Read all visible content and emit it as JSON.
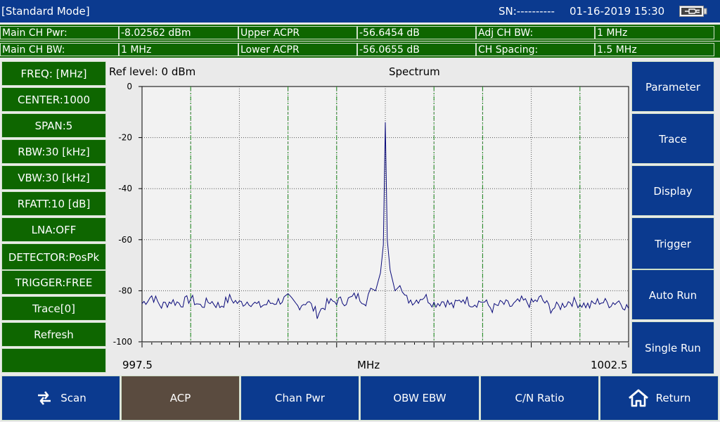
{
  "header": {
    "mode": "[Standard Mode]",
    "sn": "SN:----------",
    "datetime": "01-16-2019 15:30",
    "battery_icon": "battery-plug-icon"
  },
  "measurements": {
    "row1": [
      {
        "label": "Main CH Pwr:",
        "value": "-8.02562 dBm"
      },
      {
        "label": "Upper ACPR",
        "value": "-56.6454 dB"
      },
      {
        "label": "Adj CH BW:",
        "value": "1 MHz"
      }
    ],
    "row2": [
      {
        "label": "Main CH BW:",
        "value": "1 MHz"
      },
      {
        "label": "Lower ACPR",
        "value": "-56.0655 dB"
      },
      {
        "label": "CH Spacing:",
        "value": "1.5 MHz"
      }
    ]
  },
  "left_menu": [
    "FREQ: [MHz]",
    "CENTER:1000",
    "SPAN:5",
    "RBW:30 [kHz]",
    "VBW:30 [kHz]",
    "RFATT:10 [dB]",
    "LNA:OFF",
    "DETECTOR:PosPk",
    "TRIGGER:FREE",
    "Trace[0]",
    "Refresh"
  ],
  "right_menu": [
    "Parameter",
    "Trace",
    "Display",
    "Trigger",
    "Auto Run",
    "Single Run"
  ],
  "bottom_tabs": [
    {
      "label": "Scan",
      "icon": "swap-icon",
      "active": false
    },
    {
      "label": "ACP",
      "active": true
    },
    {
      "label": "Chan Pwr",
      "active": false
    },
    {
      "label": "OBW EBW",
      "active": false
    },
    {
      "label": "C/N Ratio",
      "active": false
    },
    {
      "label": "Return",
      "icon": "home-icon",
      "active": false
    }
  ],
  "plot": {
    "ref_level": "Ref level: 0 dBm",
    "title": "Spectrum",
    "x_start": "997.5",
    "x_unit": "MHz",
    "x_end": "1002.5"
  },
  "chart_data": {
    "type": "line",
    "title": "Spectrum",
    "xlabel": "MHz",
    "ylabel": "",
    "xlim": [
      997.5,
      1002.5
    ],
    "ylim": [
      -100,
      0
    ],
    "y_ticks": [
      0,
      -20,
      -40,
      -60,
      -80,
      -100
    ],
    "x_tick_labels": [
      "997.5",
      "1002.5"
    ],
    "grid": true,
    "channel_markers_mhz": [
      998.0,
      999.0,
      999.5,
      1000.5,
      1001.0,
      1002.0
    ],
    "series": [
      {
        "x": [
          997.5,
          997.6,
          997.7,
          997.8,
          997.9,
          998.0,
          998.1,
          998.2,
          998.3,
          998.4,
          998.5,
          998.6,
          998.7,
          998.8,
          998.9,
          999.0,
          999.1,
          999.2,
          999.3,
          999.4,
          999.5,
          999.6,
          999.7,
          999.8,
          999.85,
          999.9,
          999.95,
          999.98,
          1000.0,
          1000.02,
          1000.05,
          1000.1,
          1000.15,
          1000.2,
          1000.3,
          1000.4,
          1000.5,
          1000.6,
          1000.7,
          1000.8,
          1000.9,
          1001.0,
          1001.1,
          1001.2,
          1001.3,
          1001.4,
          1001.5,
          1001.6,
          1001.7,
          1001.8,
          1001.9,
          1002.0,
          1002.1,
          1002.2,
          1002.3,
          1002.4,
          1002.5
        ],
        "y": [
          -85,
          -82,
          -86,
          -84,
          -85,
          -83,
          -86,
          -84,
          -86,
          -83,
          -85,
          -84,
          -86,
          -85,
          -84,
          -83,
          -86,
          -84,
          -89,
          -85,
          -84,
          -84,
          -82,
          -84,
          -79,
          -80,
          -73,
          -62,
          -14,
          -60,
          -72,
          -80,
          -78,
          -83,
          -84,
          -82,
          -85,
          -84,
          -86,
          -83,
          -85,
          -84,
          -87,
          -85,
          -86,
          -84,
          -85,
          -83,
          -87,
          -86,
          -84,
          -85,
          -86,
          -84,
          -85,
          -84,
          -87
        ]
      }
    ]
  }
}
